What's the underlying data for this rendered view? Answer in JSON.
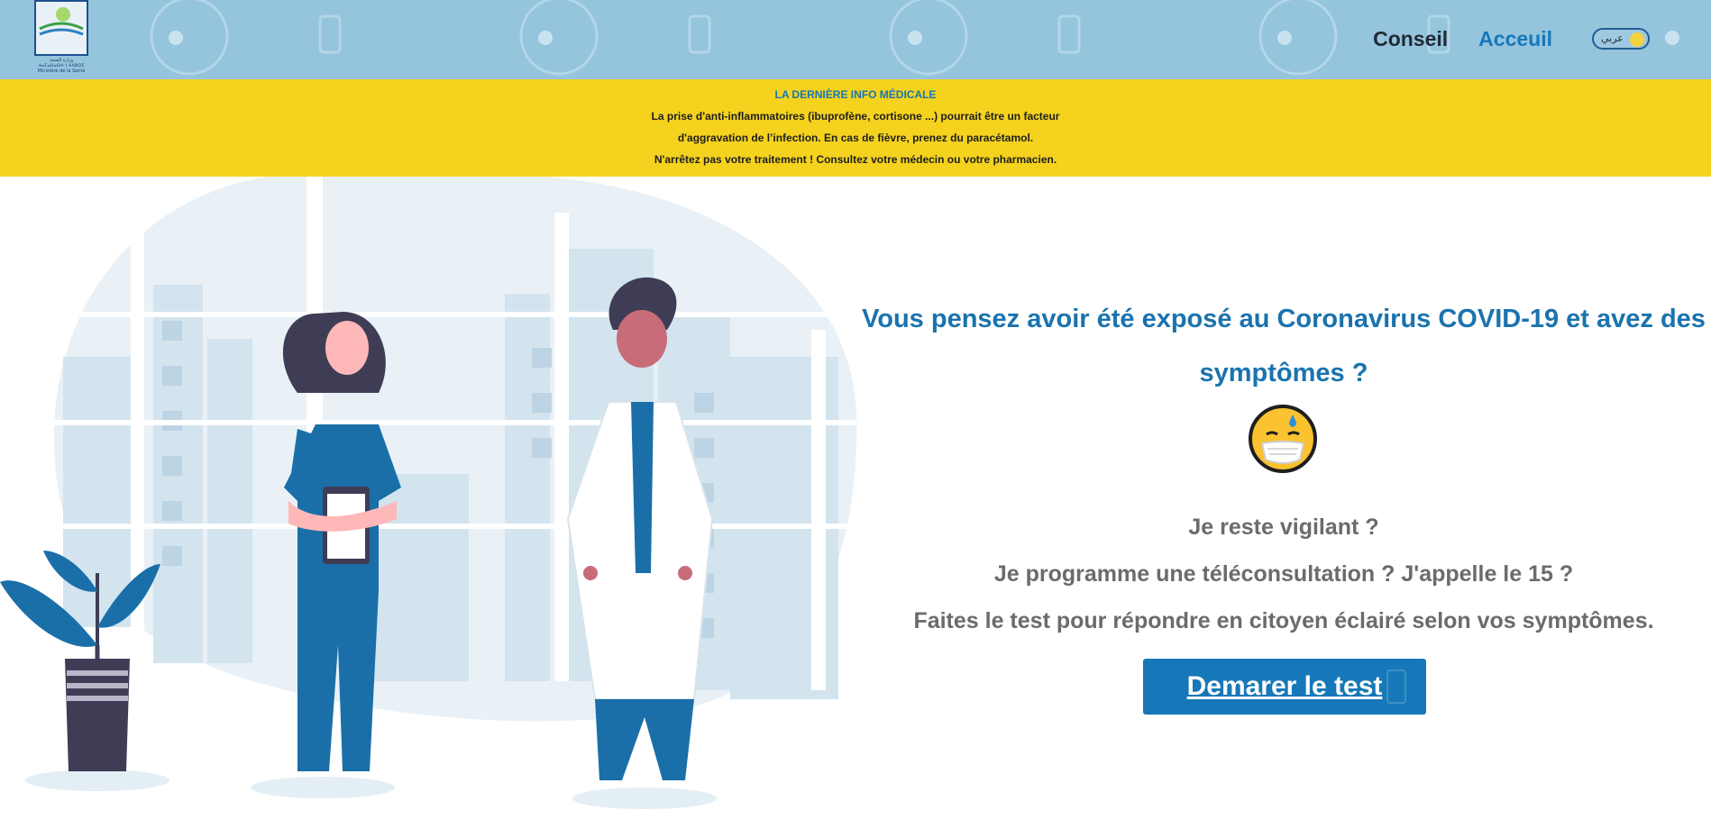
{
  "header": {
    "logo_text_1": "وزارة الصحة",
    "logo_text_2": "ⵜⴰⵎⴰⵡⴰⵙⵜ ⵏ ⵜⴷⵓⵙⵉ",
    "logo_text_3": "Ministère de la Santé",
    "nav": {
      "conseil": "Conseil",
      "accueil": "Acceuil"
    },
    "lang_toggle": "عربي"
  },
  "banner": {
    "title": "LA DERNIÈRE INFO MÉDICALE",
    "line1": "La prise d'anti-inflammatoires (ibuprofène, cortisone ...) pourrait être un facteur",
    "line2": "d'aggravation de l’infection. En cas de fièvre, prenez du paracétamol.",
    "line3": "N'arrêtez pas votre traitement ! Consultez votre médecin ou votre pharmacien."
  },
  "hero": {
    "title_line1": "Vous pensez avoir été exposé au Coronavirus COVID-19 et avez des",
    "title_line2": "symptômes ?",
    "line1": "Je reste vigilant ?",
    "line2": "Je programme une téléconsultation ? J'appelle le 15 ?",
    "line3": "Faites le test pour répondre en citoyen éclairé selon vos symptômes.",
    "cta": "Demarer le test"
  },
  "colors": {
    "header_bg": "#95c4dd",
    "banner_bg": "#f4d21e",
    "accent_blue": "#1678b8",
    "text_gray": "#6b6b6b"
  }
}
